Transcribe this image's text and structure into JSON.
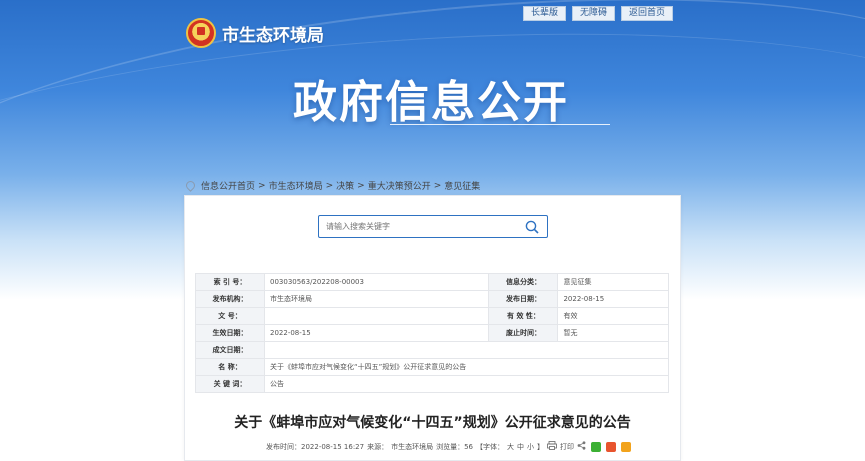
{
  "header": {
    "org_name": "市生态环境局",
    "big_title": "政府信息公开",
    "nav": [
      "长辈版",
      "无障碍",
      "返回首页"
    ]
  },
  "breadcrumb": [
    "信息公开首页",
    "市生态环境局",
    "决策",
    "重大决策预公开",
    "意见征集"
  ],
  "search": {
    "placeholder": "请输入搜索关键字"
  },
  "meta_table": {
    "index_label": "索 引 号：",
    "index_value": "003030563/202208-00003",
    "category_label": "信息分类：",
    "category_value": "意见征集",
    "publisher_label": "发布机构：",
    "publisher_value": "市生态环境局",
    "pubdate_label": "发布日期：",
    "pubdate_value": "2022-08-15",
    "docno_label": "文    号：",
    "docno_value": "",
    "validity_label": "有 效 性：",
    "validity_value": "有效",
    "effective_label": "生效日期：",
    "effective_value": "2022-08-15",
    "abolish_label": "废止时间：",
    "abolish_value": "暂无",
    "formed_label": "成文日期：",
    "formed_value": "",
    "name_label": "名    称：",
    "name_value": "关于《蚌埠市应对气候变化“十四五”规划》公开征求意见的公告",
    "keyword_label": "关 键 词：",
    "keyword_value": "公告"
  },
  "document": {
    "title": "关于《蚌埠市应对气候变化“十四五”规划》公开征求意见的公告",
    "publish_time": "发布时间：2022-08-15 16:27",
    "source": "来源：",
    "source_value": "市生态环境局",
    "views": "浏览量：56",
    "font_prefix": "【字体：",
    "font_large": "大",
    "font_medium": "中",
    "font_small": "小",
    "font_suffix": "】",
    "print": "打印"
  },
  "colors": {
    "accent": "#2e72c2",
    "wechat": "#3cb034",
    "weibo": "#e8542e",
    "qzone": "#f2a31c"
  }
}
